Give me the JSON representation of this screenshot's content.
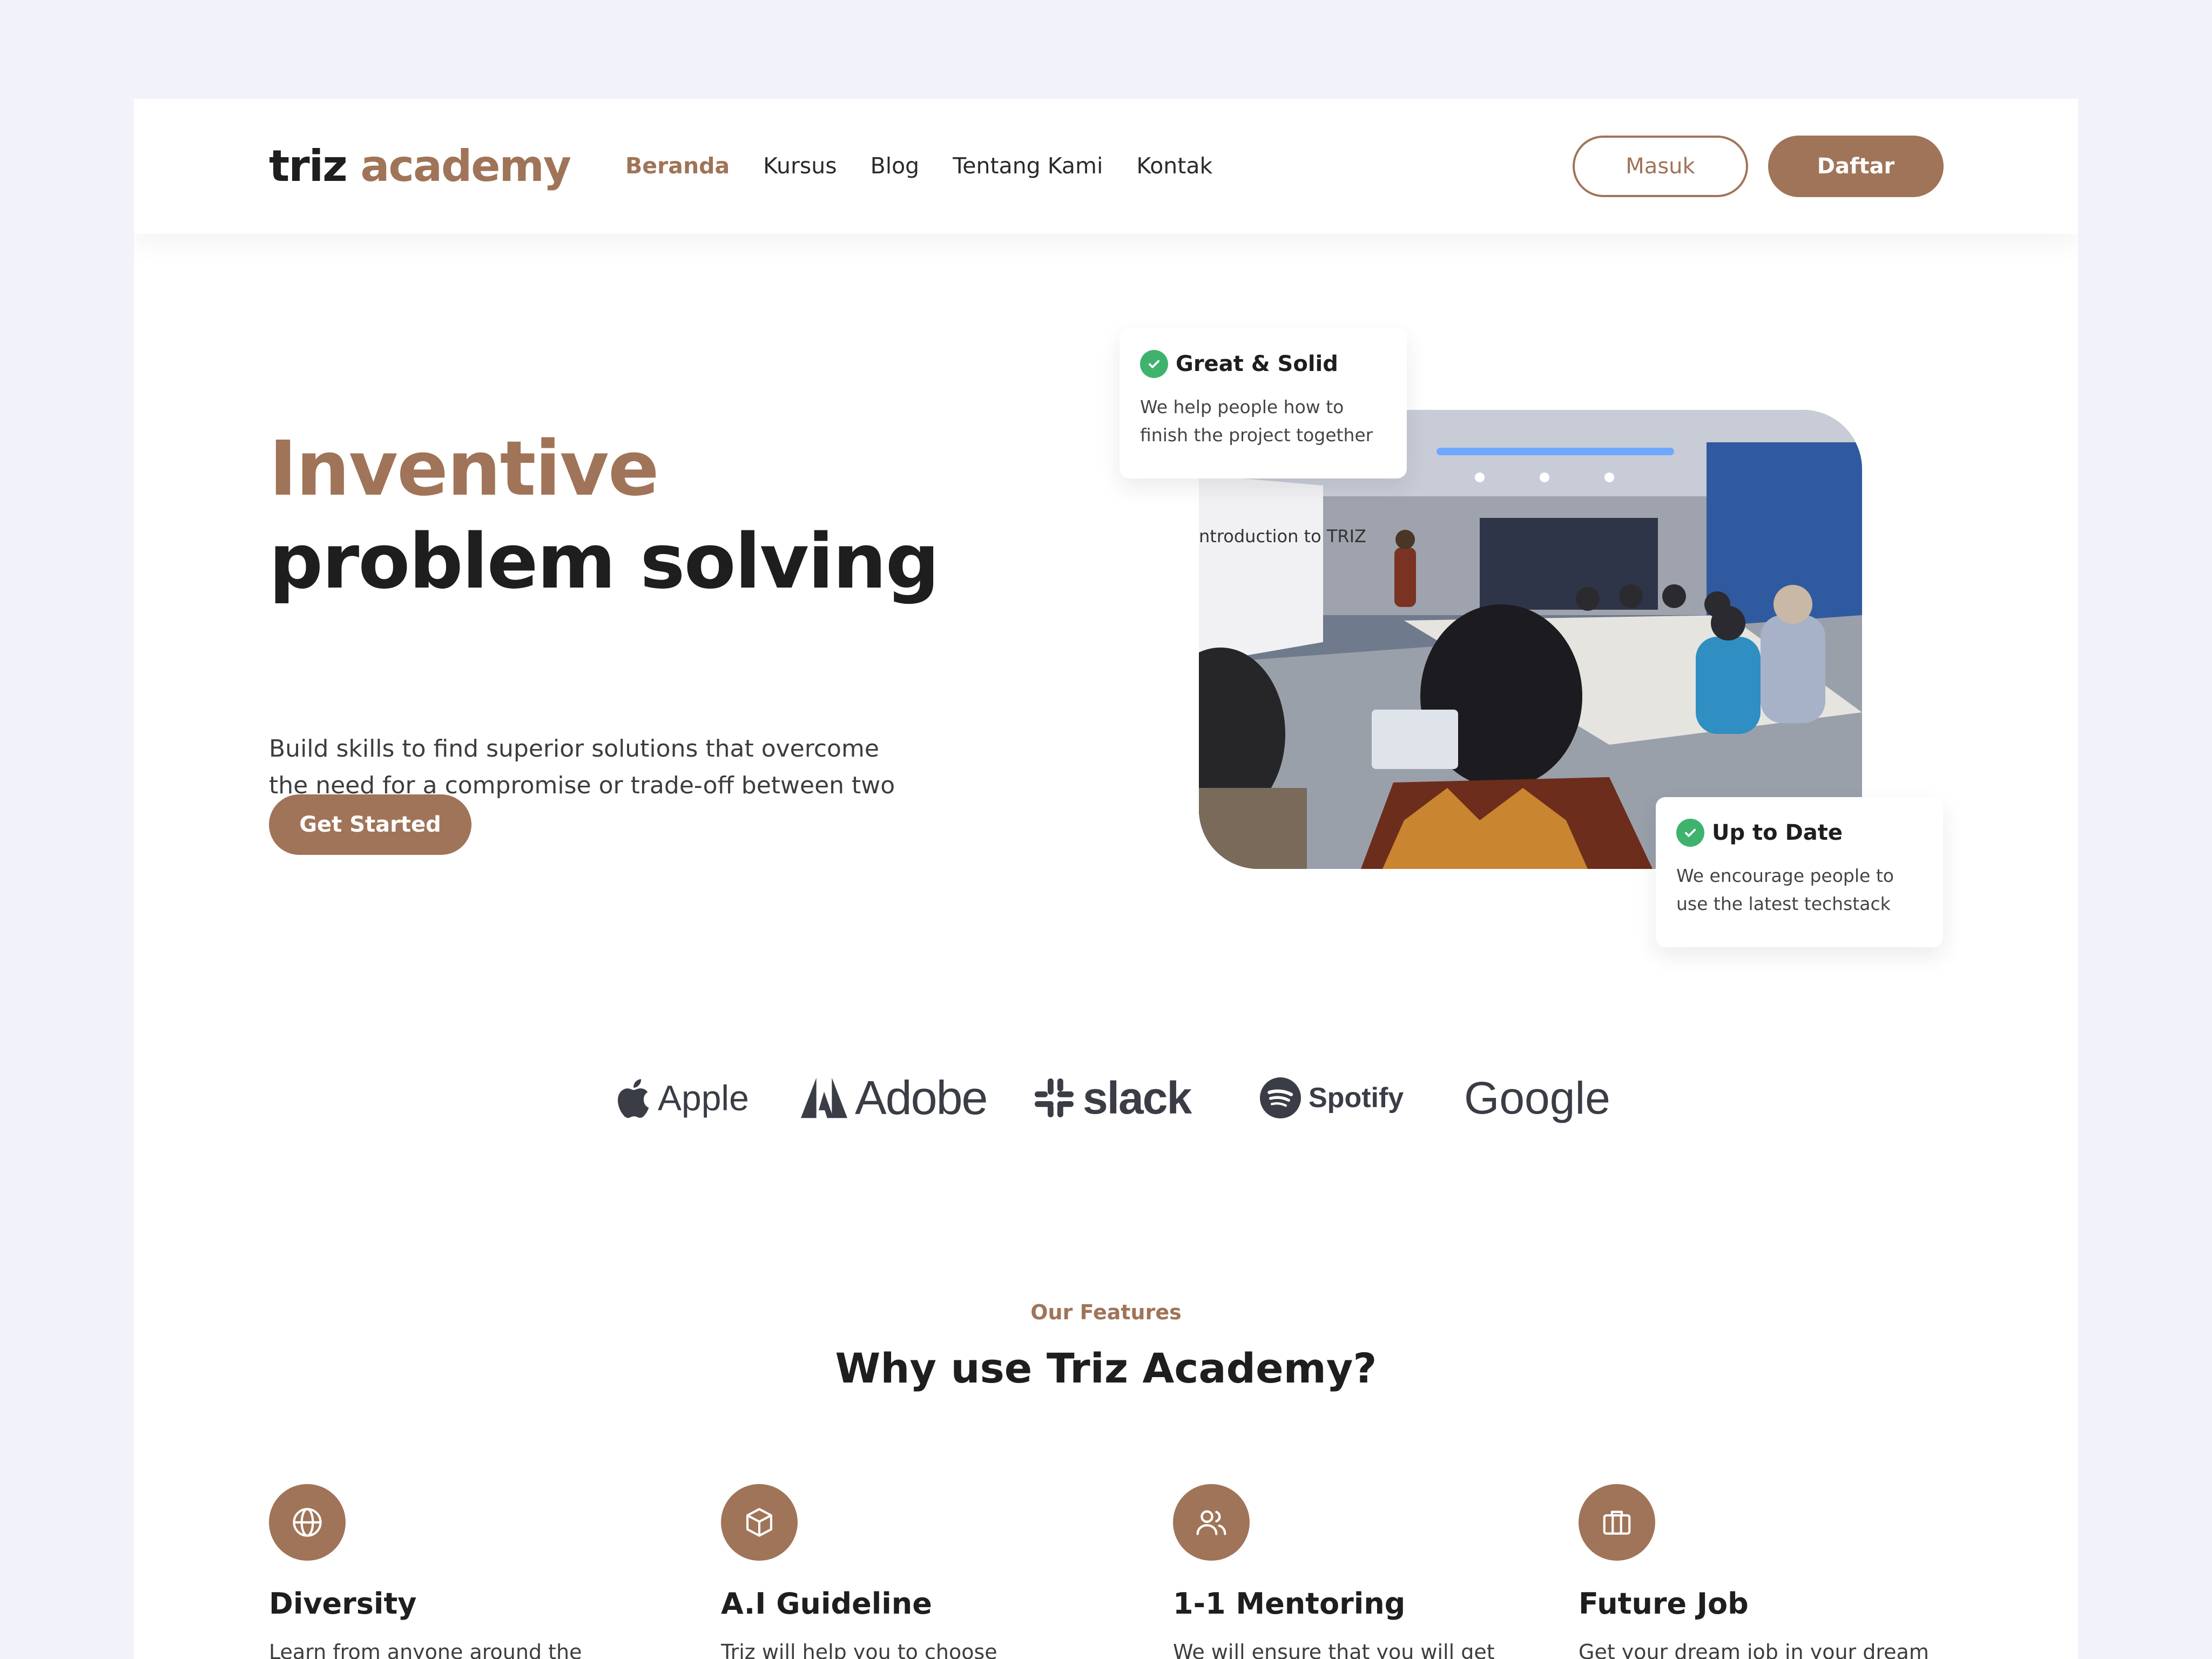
{
  "logo": {
    "part1": "triz",
    "part2": "academy"
  },
  "nav": {
    "items": [
      {
        "label": "Beranda"
      },
      {
        "label": "Kursus"
      },
      {
        "label": "Blog"
      },
      {
        "label": "Tentang Kami"
      },
      {
        "label": "Kontak"
      }
    ],
    "login_label": "Masuk",
    "signup_label": "Daftar"
  },
  "hero": {
    "title_line1": "Inventive",
    "title_line2": "problem solving",
    "description": "Build skills to find superior solutions that overcome the need for a compromise or trade-off between two elements.",
    "cta_label": "Get Started",
    "photo_slide_text": "ntroduction to TRIZ",
    "card1": {
      "title": "Great & Solid",
      "text": "We help people how to finish the project together"
    },
    "card2": {
      "title": "Up to Date",
      "text": "We encourage people to use the latest techstack"
    }
  },
  "brands": [
    {
      "name": "Apple",
      "icon": "apple-icon"
    },
    {
      "name": "Adobe",
      "icon": "adobe-icon"
    },
    {
      "name": "slack",
      "icon": "slack-icon"
    },
    {
      "name": "Spotify",
      "icon": "spotify-icon"
    },
    {
      "name": "Google",
      "icon": ""
    }
  ],
  "features": {
    "kicker": "Our Features",
    "title": "Why use Triz Academy?",
    "items": [
      {
        "title": "Diversity",
        "text": "Learn from anyone around the",
        "icon": "globe-icon"
      },
      {
        "title": "A.I Guideline",
        "text": "Triz will help you to choose",
        "icon": "cube-icon"
      },
      {
        "title": "1-1 Mentoring",
        "text": "We will ensure that you will get",
        "icon": "users-icon"
      },
      {
        "title": "Future Job",
        "text": "Get your dream job in your dream",
        "icon": "briefcase-icon"
      }
    ]
  },
  "colors": {
    "accent": "#a07458",
    "success": "#3fb36e",
    "background": "#f1f2fa",
    "text": "#1e1e1e"
  }
}
